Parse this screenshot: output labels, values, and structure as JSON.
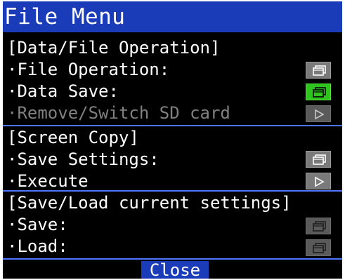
{
  "window": {
    "title": "File Menu"
  },
  "sections": [
    {
      "header": "[Data/File Operation]",
      "items": [
        {
          "label": "·File Operation:",
          "icon": "window-icon",
          "state": "normal"
        },
        {
          "label": "·Data Save:",
          "icon": "window-icon",
          "state": "active"
        },
        {
          "label": "·Remove/Switch SD card",
          "icon": "play-icon",
          "state": "disabled"
        }
      ]
    },
    {
      "header": "[Screen Copy]",
      "items": [
        {
          "label": "·Save Settings:",
          "icon": "window-icon",
          "state": "normal"
        },
        {
          "label": "·Execute",
          "icon": "play-icon",
          "state": "normal"
        }
      ]
    },
    {
      "header": "[Save/Load current settings]",
      "items": [
        {
          "label": "·Save:",
          "icon": "window-icon",
          "state": "dim"
        },
        {
          "label": "·Load:",
          "icon": "window-icon",
          "state": "dim"
        }
      ]
    }
  ],
  "footer": {
    "close_label": "Close"
  },
  "colors": {
    "title_bar": "#1a3cb8",
    "divider": "#4f76ff",
    "active_icon": "#2ec31d",
    "icon_normal": "#7a7a7a",
    "icon_dim": "#5a5a5a",
    "disabled_text": "#808080"
  }
}
